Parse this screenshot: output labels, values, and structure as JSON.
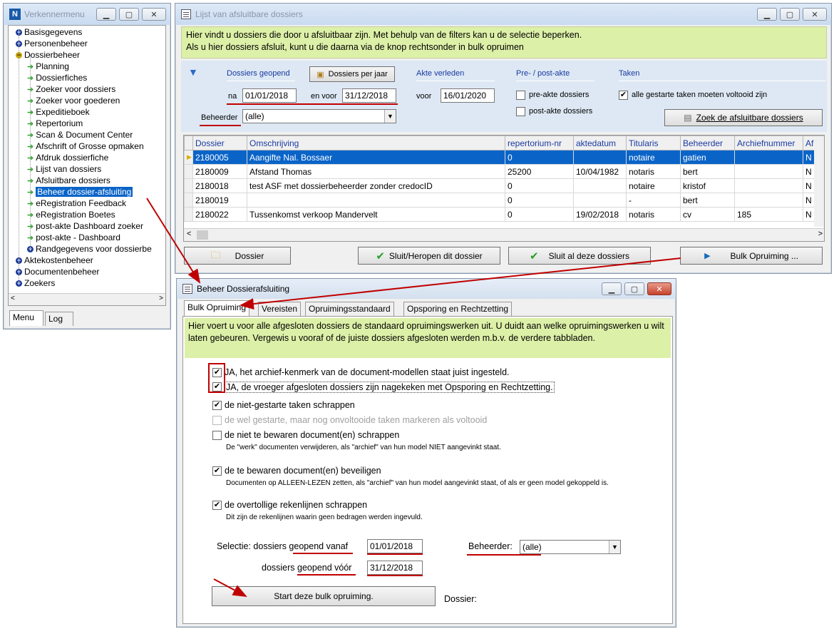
{
  "menu": {
    "title": "Verkennermenu",
    "items": [
      {
        "label": "Basisgegevens",
        "type": "plus"
      },
      {
        "label": "Personenbeheer",
        "type": "plus"
      },
      {
        "label": "Dossierbeheer",
        "type": "minus"
      },
      {
        "label": "Planning",
        "type": "child"
      },
      {
        "label": "Dossierfiches",
        "type": "child"
      },
      {
        "label": "Zoeker voor dossiers",
        "type": "child"
      },
      {
        "label": "Zoeker voor goederen",
        "type": "child"
      },
      {
        "label": "Expeditieboek",
        "type": "child"
      },
      {
        "label": "Repertorium",
        "type": "child"
      },
      {
        "label": "Scan & Document Center",
        "type": "child"
      },
      {
        "label": "Afschrift of Grosse opmaken",
        "type": "child"
      },
      {
        "label": "Afdruk dossierfiche",
        "type": "child"
      },
      {
        "label": "Lijst van dossiers",
        "type": "child"
      },
      {
        "label": "Afsluitbare dossiers",
        "type": "child"
      },
      {
        "label": "Beheer dossier-afsluiting",
        "type": "child",
        "selected": true
      },
      {
        "label": "eRegistration Feedback",
        "type": "child"
      },
      {
        "label": "eRegistration Boetes",
        "type": "child"
      },
      {
        "label": "post-akte Dashboard zoeker",
        "type": "child"
      },
      {
        "label": "post-akte - Dashboard",
        "type": "child"
      },
      {
        "label": "Randgegevens voor dossierbe",
        "type": "childplus"
      },
      {
        "label": "Aktekostenbeheer",
        "type": "plus"
      },
      {
        "label": "Documentenbeheer",
        "type": "plus"
      },
      {
        "label": "Zoekers",
        "type": "plus"
      }
    ],
    "tabs": {
      "menu": "Menu",
      "log": "Log"
    }
  },
  "lijst": {
    "title": "Lijst van afsluitbare dossiers",
    "info1": "Hier vindt u dossiers die door u afsluitbaar zijn. Met behulp van de filters kan u de selectie beperken.",
    "info2": "Als u hier dossiers afsluit, kunt u die daarna via de knop rechtsonder in bulk opruimen",
    "filters": {
      "geopend_label": "Dossiers geopend",
      "per_jaar": "Dossiers per jaar",
      "na_label": "na",
      "na_value": "01/01/2018",
      "envoor_label": "en voor",
      "envoor_value": "31/12/2018",
      "beheerder_label": "Beheerder",
      "beheerder_value": "(alle)",
      "akte_label": "Akte verleden",
      "voor_label": "voor",
      "voor_value": "16/01/2020",
      "prepost_label": "Pre- / post-akte",
      "pre_label": "pre-akte dossiers",
      "post_label": "post-akte dossiers",
      "taken_label": "Taken",
      "taken_check": "alle gestarte taken moeten voltooid zijn",
      "zoek_button": "Zoek de afsluitbare dossiers"
    },
    "columns": [
      "Dossier",
      "Omschrijving",
      "repertorium-nr",
      "aktedatum",
      "Titularis",
      "Beheerder",
      "Archiefnummer",
      "Af"
    ],
    "rows": [
      [
        "2180005",
        "Aangifte Nal. Bossaer",
        "0",
        "",
        "notaire",
        "gatien",
        "",
        "N"
      ],
      [
        "2180009",
        "Afstand Thomas",
        "25200",
        "10/04/1982",
        "notaris",
        "bert",
        "",
        "N"
      ],
      [
        "2180018",
        "test ASF met dossierbeheerder zonder credocID",
        "0",
        "",
        "notaire",
        "kristof",
        "",
        "N"
      ],
      [
        "2180019",
        "",
        "0",
        "",
        "-",
        "bert",
        "",
        "N"
      ],
      [
        "2180022",
        "Tussenkomst verkoop Mandervelt",
        "0",
        "19/02/2018",
        "notaris",
        "cv",
        "185",
        "N"
      ]
    ],
    "buttons": {
      "dossier": "Dossier",
      "sluit": "Sluit/Heropen dit dossier",
      "sluit_al": "Sluit al deze dossiers",
      "bulk": "Bulk Opruiming ..."
    }
  },
  "beheer": {
    "title": "Beheer Dossierafsluiting",
    "tabs": [
      "Bulk Opruiming",
      "Vereisten",
      "Opruimingsstandaard",
      "Opsporing en Rechtzetting"
    ],
    "info": "Hier voert u voor alle afgesloten dossiers de standaard opruimingswerken uit.  U duidt aan welke opruimingswerken u wilt laten gebeuren.  Vergewis u vooraf of de juiste dossiers afgesloten werden m.b.v. de verdere tabbladen.",
    "checks": {
      "ja1": "JA, het archief-kenmerk van de document-modellen staat juist ingesteld.",
      "ja2": "JA, de vroeger afgesloten dossiers zijn nagekeken met Opsporing en Rechtzetting.",
      "c1": "de niet-gestarte taken schrappen",
      "c2": "de wel gestarte, maar nog onvoltooide taken markeren als voltooid",
      "c3": "de niet te bewaren document(en) schrappen",
      "c3_sub": "De \"werk\" documenten verwijderen, als \"archief\" van hun model NIET aangevinkt staat.",
      "c4": "de te bewaren document(en) beveiligen",
      "c4_sub": "Documenten op ALLEEN-LEZEN zetten, als \"archief\" van hun model aangevinkt staat, of als er geen model gekoppeld is.",
      "c5": "de overtollige rekenlijnen schrappen",
      "c5_sub": "Dit zijn de rekenlijnen waarin geen bedragen werden ingevuld."
    },
    "selectie_label": "Selectie: dossiers geopend vanaf",
    "vanaf_value": "01/01/2018",
    "voor_label": "dossiers geopend vóór",
    "voor_value": "31/12/2018",
    "beheerder_label": "Beheerder:",
    "beheerder_value": "(alle)",
    "start_button": "Start deze bulk opruiming.",
    "dossier_label": "Dossier:"
  },
  "colors": {
    "highlight": "#ddf0a8",
    "selection": "#0a64c8",
    "annotation": "#c00000"
  }
}
